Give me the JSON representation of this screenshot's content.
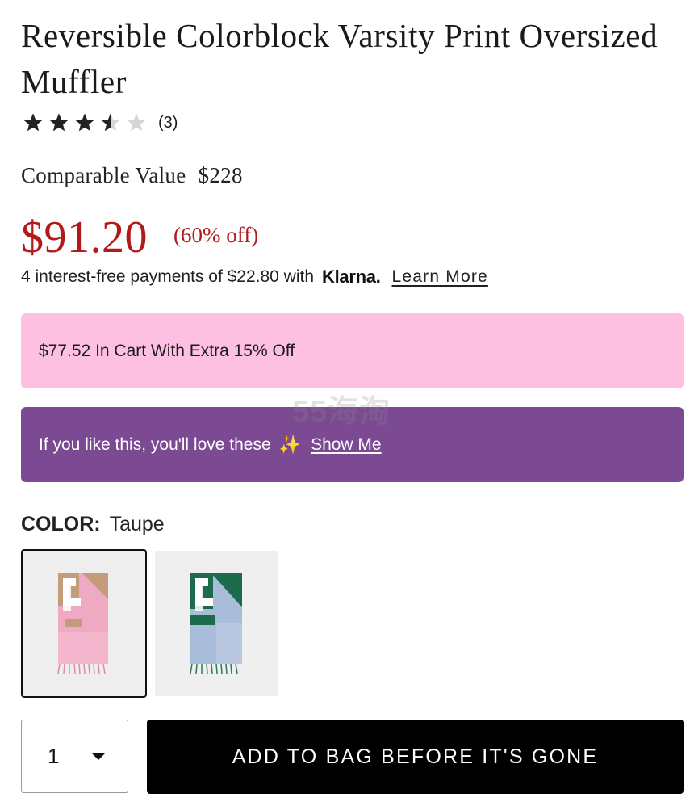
{
  "product": {
    "title": "Reversible Colorblock Varsity Print Oversized Muffler",
    "rating": 3.5,
    "rating_max": 5,
    "review_count": "(3)"
  },
  "pricing": {
    "comparable_label": "Comparable Value",
    "comparable_price": "$228",
    "price": "$91.20",
    "discount": "(60% off)"
  },
  "klarna": {
    "text": "4 interest-free payments of $22.80 with",
    "logo": "Klarna.",
    "learn_more": "Learn More"
  },
  "promos": {
    "cart_offer": "$77.52 In Cart With Extra 15% Off",
    "recommend_text": "If you like this, you'll love these",
    "recommend_icon": "sparkles-icon",
    "show_me": "Show Me"
  },
  "watermark": "55海淘",
  "color": {
    "label": "COLOR:",
    "selected": "Taupe",
    "swatches": [
      {
        "name": "Taupe",
        "selected": true
      },
      {
        "name": "Green",
        "selected": false
      }
    ]
  },
  "purchase": {
    "quantity": "1",
    "add_to_bag": "ADD TO BAG BEFORE IT'S GONE"
  },
  "colors": {
    "sale_red": "#b21a1a",
    "promo_pink": "#fdc0e1",
    "promo_purple": "#7b4a93",
    "button_black": "#000000"
  }
}
